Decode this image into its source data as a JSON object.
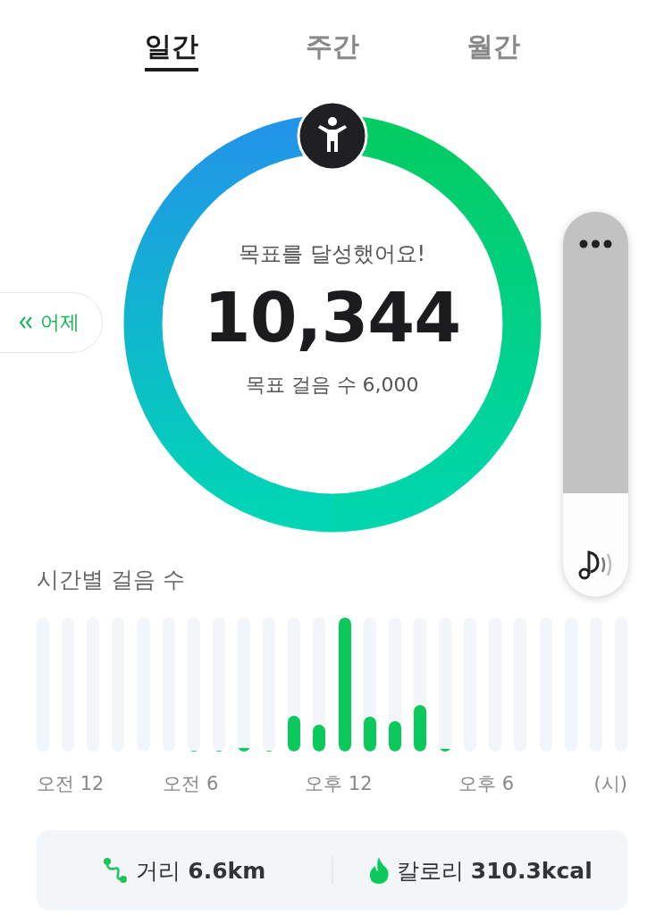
{
  "tabs": [
    {
      "label": "일간",
      "selected": true
    },
    {
      "label": "주간",
      "selected": false
    },
    {
      "label": "월간",
      "selected": false
    }
  ],
  "yesterday_button": {
    "label": "어제"
  },
  "goal": {
    "status": "목표를 달성했어요!",
    "steps": "10,344",
    "target": "목표 걸음 수 6,000"
  },
  "hourly": {
    "title": "시간별 걸음 수",
    "bars": [
      {
        "kind": "empty"
      },
      {
        "kind": "empty"
      },
      {
        "kind": "empty"
      },
      {
        "kind": "empty"
      },
      {
        "kind": "empty"
      },
      {
        "kind": "empty"
      },
      {
        "kind": "steps",
        "level": 0.01
      },
      {
        "kind": "steps",
        "level": 0.01
      },
      {
        "kind": "steps",
        "level": 0.03
      },
      {
        "kind": "steps",
        "level": 0.01
      },
      {
        "kind": "steps",
        "level": 0.27
      },
      {
        "kind": "steps",
        "level": 0.2
      },
      {
        "kind": "steps",
        "level": 1
      },
      {
        "kind": "steps",
        "level": 0.26
      },
      {
        "kind": "steps",
        "level": 0.23
      },
      {
        "kind": "steps",
        "level": 0.35
      },
      {
        "kind": "steps",
        "level": 0.02
      },
      {
        "kind": "empty"
      },
      {
        "kind": "empty"
      },
      {
        "kind": "empty"
      },
      {
        "kind": "empty"
      },
      {
        "kind": "empty"
      },
      {
        "kind": "empty"
      },
      {
        "kind": "empty"
      }
    ],
    "axis_labels": [
      "오전 12",
      "오전 6",
      "오후 12",
      "오후 6",
      "(시)"
    ]
  },
  "summary": [
    {
      "kind": "distance",
      "label": "거리",
      "value": "6.6km"
    },
    {
      "kind": "calories",
      "label": "칼로리",
      "value": "310.3kcal"
    }
  ],
  "volume_panel": {
    "level": 0.27
  }
}
